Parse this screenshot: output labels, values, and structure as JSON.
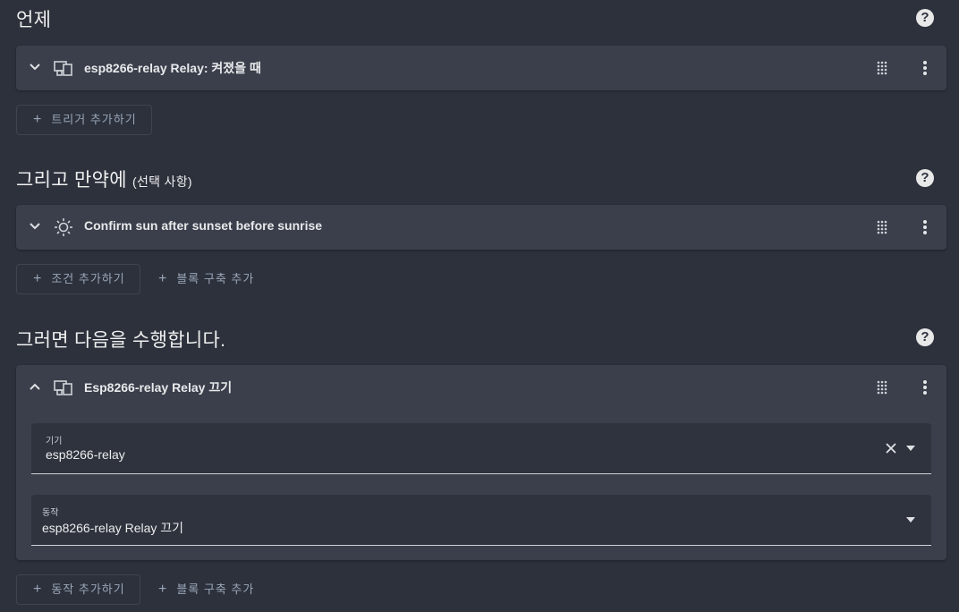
{
  "sections": {
    "when": {
      "title": "언제",
      "card_title": "esp8266-relay Relay: 켜졌을 때",
      "add_button": "트리거 추가하기"
    },
    "and_if": {
      "title": "그리고 만약에",
      "subtitle": "(선택 사항)",
      "card_title": "Confirm sun after sunset before sunrise",
      "add_button": "조건 추가하기",
      "block_button": "블록 구축 추가"
    },
    "then": {
      "title": "그러면 다음을 수행합니다.",
      "card_title": "Esp8266-relay Relay 끄기",
      "device_label": "기기",
      "device_value": "esp8266-relay",
      "action_label": "동작",
      "action_value": "esp8266-relay Relay 끄기",
      "add_button": "동작 추가하기",
      "block_button": "블록 구축 추가"
    }
  },
  "help_glyph": "?",
  "plus_glyph": "+",
  "icons": {
    "device": "device-icon",
    "sun": "sun-icon",
    "drag": "drag-handle-icon",
    "menu": "more-vertical-icon",
    "help": "help-circle-icon",
    "chevron": "chevron-icon",
    "clear": "close-icon",
    "dropdown": "caret-down-icon"
  },
  "colors": {
    "background": "#2c313c",
    "card": "#3a3f4b",
    "field": "#2e333e",
    "button_text": "#9aa6b8"
  }
}
